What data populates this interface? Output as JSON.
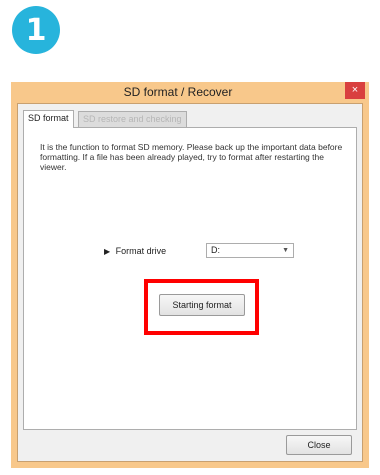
{
  "step": {
    "number": "1"
  },
  "window": {
    "title": "SD format / Recover",
    "close_glyph": "×"
  },
  "tabs": [
    {
      "label": "SD format",
      "active": true
    },
    {
      "label": "SD restore and checking",
      "active": false
    }
  ],
  "panel": {
    "description": "It is the function to format SD memory.  Please back up the important data before formatting.  If a file has been already played, try to format after restarting the viewer.",
    "format_drive_label": "Format drive",
    "drive_value": "D:",
    "start_button_label": "Starting format"
  },
  "footer": {
    "close_button_label": "Close"
  },
  "colors": {
    "badge": "#27b4dc",
    "title_bar": "#f8c88b",
    "close_button": "#d9403f",
    "highlight": "#ff0000"
  },
  "icons": {
    "arrow": "right-triangle-icon",
    "dropdown": "chevron-down-icon",
    "close": "close-icon"
  }
}
